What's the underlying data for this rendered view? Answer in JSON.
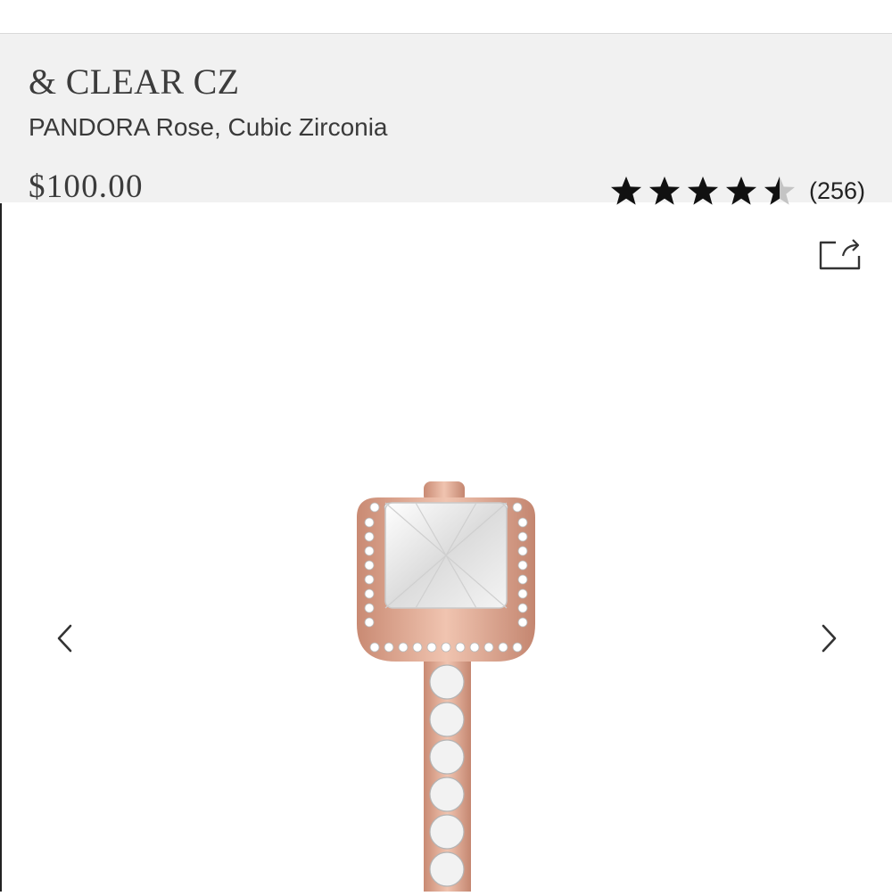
{
  "product": {
    "title": "& CLEAR CZ",
    "subtitle": "PANDORA Rose, Cubic Zirconia",
    "price": "$100.00"
  },
  "rating": {
    "stars": 4.5,
    "max_stars": 5,
    "review_count": "(256)",
    "star_color": "#111111"
  },
  "gallery": {
    "share_icon": "share-icon",
    "prev_icon": "chevron-left-icon",
    "next_icon": "chevron-right-icon",
    "image_subject": "rose gold ring with square clear cubic zirconia halo"
  },
  "colors": {
    "panel_background": "#f1f1f1",
    "text": "#3c3c3c",
    "rose_gold": "#d9a08a"
  }
}
